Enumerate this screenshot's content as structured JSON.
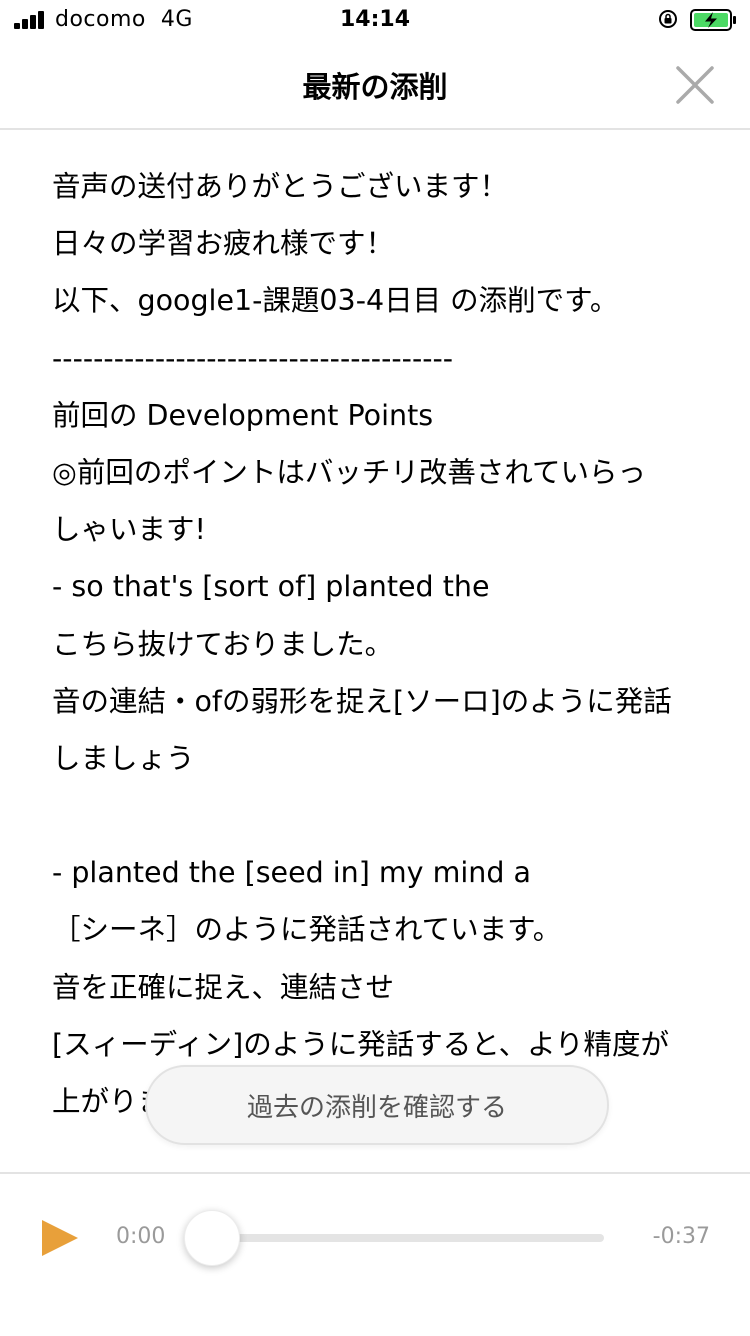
{
  "status_bar": {
    "carrier": "docomo",
    "network": "4G",
    "time": "14:14"
  },
  "nav": {
    "title": "最新の添削",
    "close_icon": "close-icon"
  },
  "body_lines": [
    "音声の送付ありがとうございます！",
    "日々の学習お疲れ様です！",
    "以下、google1-課題03-4日目 の添削です。",
    "---------------------------------------",
    "前回の Development Points",
    "◎前回のポイントはバッチリ改善されていらっ",
    "しゃいます!",
    "- so that's [sort of]  planted the",
    "こちら抜けておりました。",
    "音の連結・ofの弱形を捉え[ソーロ]のように発話",
    "しましょう",
    "",
    "- planted the [seed in]  my mind a",
    "［シーネ］のように発話されています。",
    "音を正確に捉え、連結させ",
    "[スィーディン]のように発話すると、より精度が",
    "上がります"
  ],
  "history_button_label": "過去の添削を確認する",
  "player": {
    "elapsed": "0:00",
    "remaining": "-0:37",
    "progress": 0,
    "play_icon": "play-icon",
    "accent_color": "#E8A03A"
  }
}
